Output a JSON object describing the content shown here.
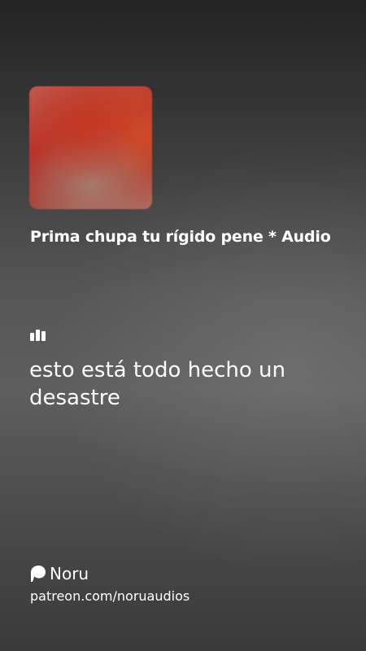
{
  "track": {
    "title": "Prima chupa tu rígido pene * Audio",
    "cover_colors": [
      "#b8332a",
      "#c05a4e",
      "#a8786a"
    ]
  },
  "lyric": {
    "text": "esto está todo hecho un desastre"
  },
  "creator": {
    "icon": "patreon-icon",
    "name": "Noru",
    "link": "patreon.com/noruaudios"
  },
  "icons": {
    "lyric_indicator": "audio-bars-icon"
  },
  "colors": {
    "text": "#ffffff",
    "background_top": "#232323",
    "background_mid": "#5e5e5e"
  }
}
